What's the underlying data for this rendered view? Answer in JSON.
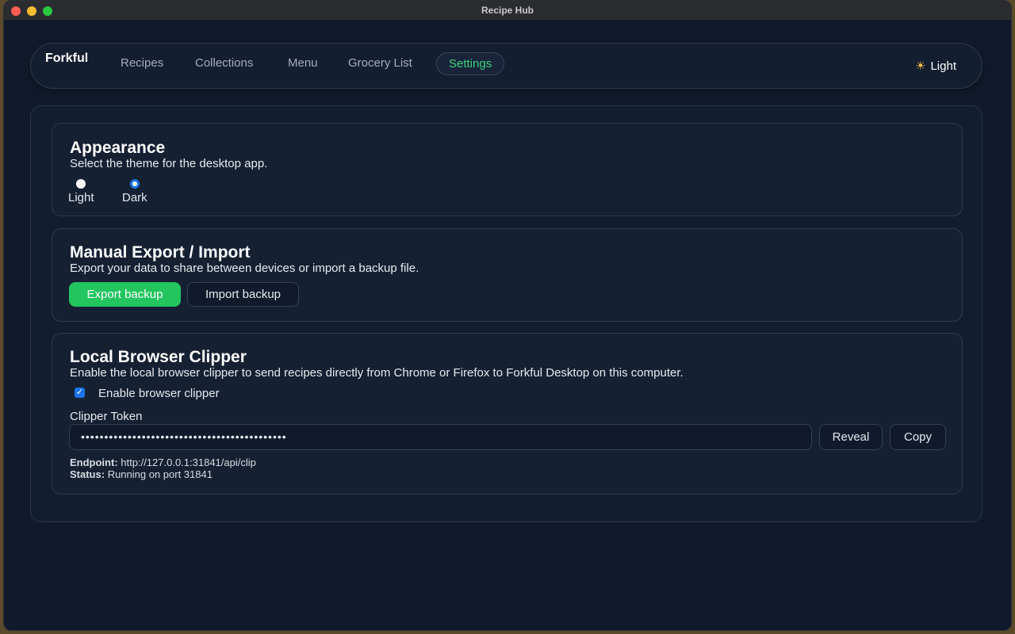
{
  "window": {
    "title": "Recipe Hub"
  },
  "nav": {
    "brand": "Forkful",
    "links": [
      "Recipes",
      "Collections",
      "Menu",
      "Grocery List",
      "Settings"
    ],
    "active": "Settings",
    "theme_toggle": "Light"
  },
  "appearance": {
    "title": "Appearance",
    "desc": "Select the theme for the desktop app.",
    "options": [
      "Light",
      "Dark"
    ],
    "selected": "Dark"
  },
  "export": {
    "title": "Manual Export / Import",
    "desc": "Export your data to share between devices or import a backup file.",
    "export_label": "Export backup",
    "import_label": "Import backup"
  },
  "clipper": {
    "title": "Local Browser Clipper",
    "desc": "Enable the local browser clipper to send recipes directly from Chrome or Firefox to Forkful Desktop on this computer.",
    "enable_label": "Enable browser clipper",
    "enabled": true,
    "token_label": "Clipper Token",
    "token_value": "••••••••••••••••••••••••••••••••••••••••••••",
    "reveal_label": "Reveal",
    "copy_label": "Copy",
    "endpoint_label": "Endpoint:",
    "endpoint_value": "http://127.0.0.1:31841/api/clip",
    "status_label": "Status:",
    "status_value": "Running on port 31841"
  },
  "colors": {
    "accent": "#22c55e",
    "active_nav": "#3ed07a",
    "background": "#111a2c",
    "radio_selected": "#1a73e8"
  }
}
